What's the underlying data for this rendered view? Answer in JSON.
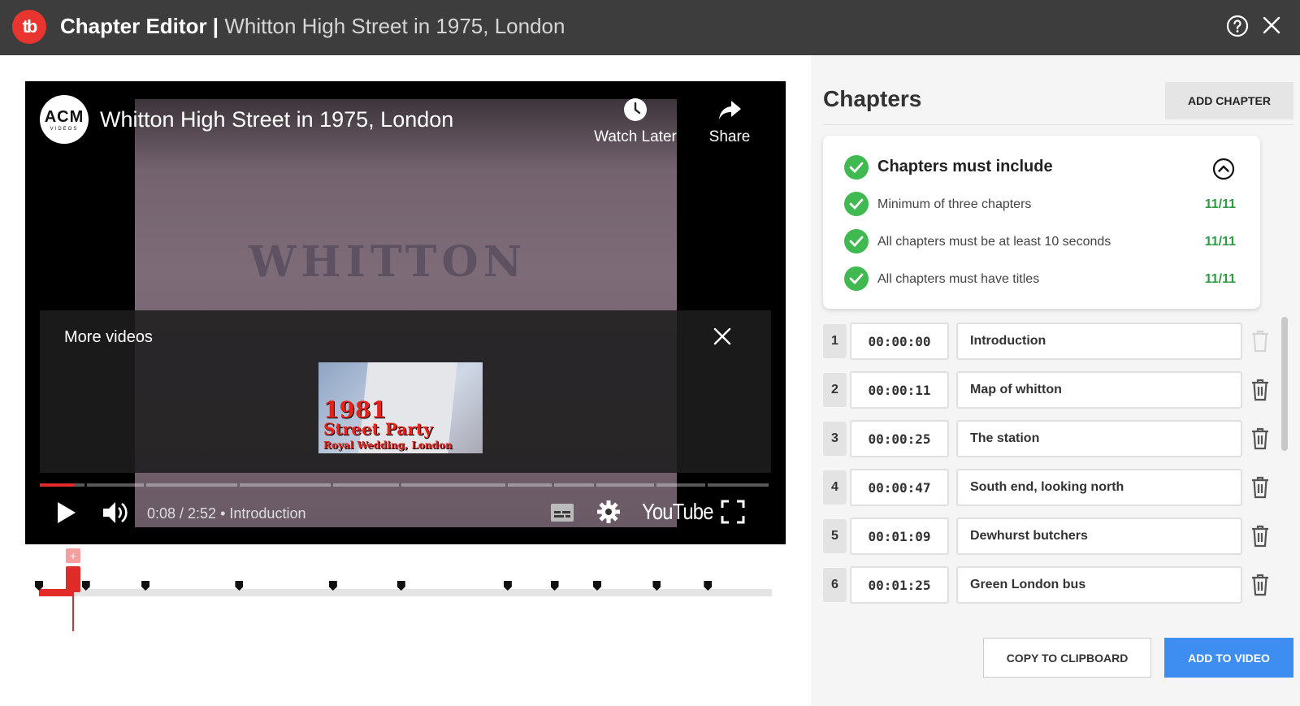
{
  "app": {
    "title_bold": "Chapter Editor |",
    "title_rest": "Whitton High Street in 1975, London",
    "logo_text": "tb",
    "brand_color": "#e8352f"
  },
  "video": {
    "title": "Whitton High Street in 1975, London",
    "channel_logo": {
      "line1": "ACM",
      "line2": "VIDEOS"
    },
    "frame_text": "WHITTON",
    "watch_later": "Watch Later",
    "share": "Share",
    "more_videos": "More videos",
    "thumb": {
      "line1": "1981",
      "line2": "Street Party",
      "line3": "Royal Wedding, London"
    },
    "current_time": "0:08",
    "duration": "2:52",
    "chapter_name": "Introduction",
    "time_display": "0:08 / 2:52",
    "youtube_label": "YouTube"
  },
  "sidebar": {
    "heading": "Chapters",
    "add_chapter": "ADD CHAPTER",
    "rules": {
      "title": "Chapters must include",
      "items": [
        {
          "text": "Minimum of three chapters",
          "count": "11/11"
        },
        {
          "text": "All chapters must be at least 10 seconds",
          "count": "11/11"
        },
        {
          "text": "All chapters must have titles",
          "count": "11/11"
        }
      ]
    },
    "chapters": [
      {
        "num": "1",
        "time": "00:00:00",
        "title": "Introduction"
      },
      {
        "num": "2",
        "time": "00:00:11",
        "title": "Map of whitton"
      },
      {
        "num": "3",
        "time": "00:00:25",
        "title": "The station"
      },
      {
        "num": "4",
        "time": "00:00:47",
        "title": "South end, looking north"
      },
      {
        "num": "5",
        "time": "00:01:09",
        "title": "Dewhurst butchers"
      },
      {
        "num": "6",
        "time": "00:01:25",
        "title": "Green London bus"
      }
    ],
    "copy_button": "COPY TO CLIPBOARD",
    "add_to_video_button": "ADD TO VIDEO"
  },
  "timeline": {
    "chapter_start_seconds": [
      0,
      11,
      25,
      47,
      69,
      85
    ],
    "duration_seconds": 172,
    "current_seconds": 8
  }
}
